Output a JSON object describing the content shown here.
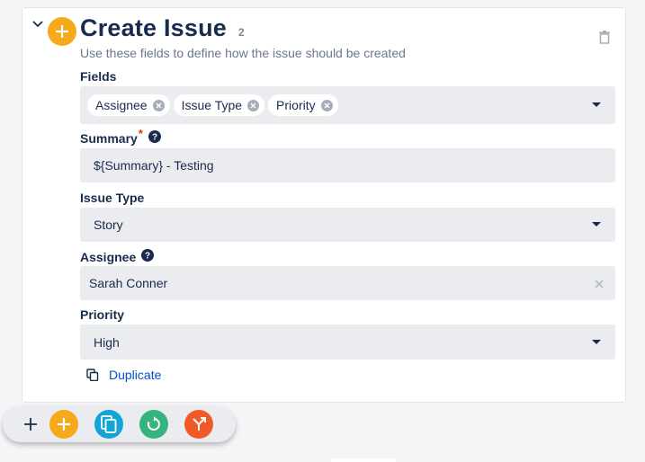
{
  "step": {
    "title": "Create Issue",
    "count": "2",
    "subtitle": "Use these fields to define how the issue should be created"
  },
  "fields_selector": {
    "label": "Fields",
    "chips": [
      "Assignee",
      "Issue Type",
      "Priority"
    ]
  },
  "summary": {
    "label": "Summary",
    "required_mark": "*",
    "value": "${Summary} - Testing"
  },
  "issue_type": {
    "label": "Issue Type",
    "value": "Story"
  },
  "assignee": {
    "label": "Assignee",
    "value": "Sarah Conner"
  },
  "priority": {
    "label": "Priority",
    "value": "High"
  },
  "duplicate": {
    "label": "Duplicate"
  },
  "toolbar": {
    "buttons": [
      "add-step",
      "copy",
      "refresh",
      "branch"
    ]
  },
  "colors": {
    "accent_orange": "#f6a91b",
    "copy_blue": "#12a5d6",
    "refresh_green": "#36b37e",
    "branch_red": "#f05a28",
    "link_blue": "#0052cc",
    "required_red": "#de350b"
  }
}
